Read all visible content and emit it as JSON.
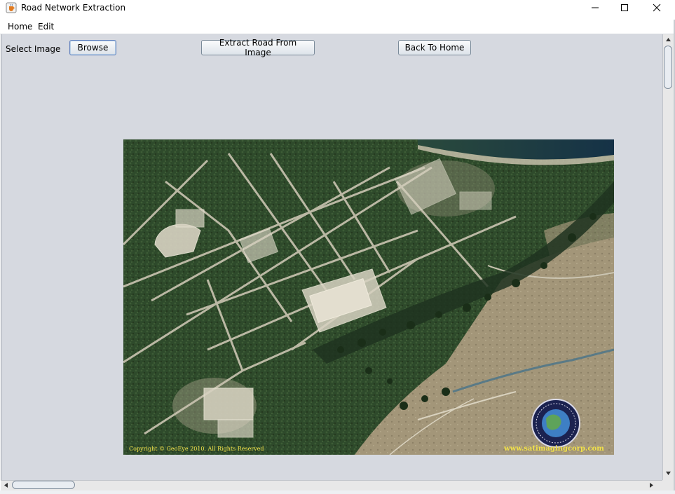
{
  "window": {
    "title": "Road Network Extraction",
    "app_icon": "java-cup-icon",
    "controls": [
      "minimize-icon",
      "maximize-icon",
      "close-icon"
    ]
  },
  "menu": {
    "items": [
      {
        "label": "Home"
      },
      {
        "label": "Edit"
      }
    ]
  },
  "toolbar": {
    "select_label": "Select Image",
    "browse_label": "Browse",
    "extract_label": "Extract Road From Image",
    "back_label": "Back To Home"
  },
  "image": {
    "kind": "satellite aerial photo",
    "copyright": "Copyright © GeoEye 2010. All Rights Reserved",
    "watermark_url": "www.satimagingcorp.com",
    "logo": "satellite-imaging-corporation-logo"
  },
  "colors": {
    "panel_bg": "#d6d9e0",
    "vegetation": "#2f4a2a",
    "roads": "#c9c3b0",
    "sand": "#a89a7e",
    "water": "#1c3a4c",
    "watermark": "#f0e04a"
  }
}
